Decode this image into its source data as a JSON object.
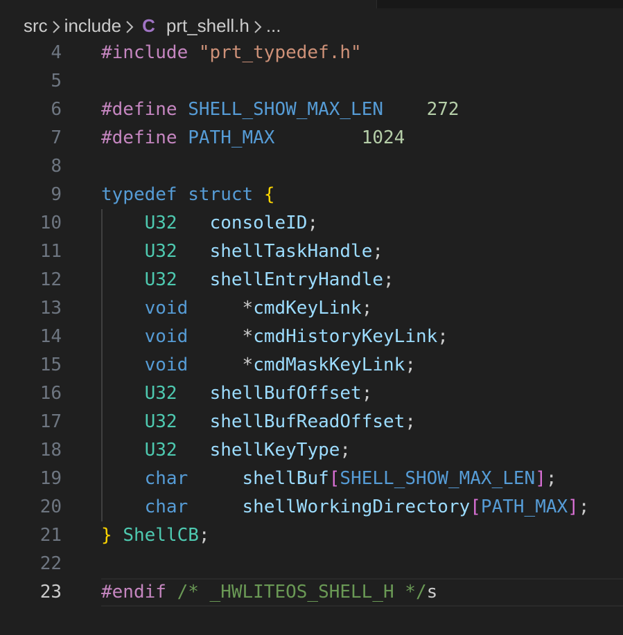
{
  "breadcrumb": {
    "items": [
      "src",
      "include",
      "prt_shell.h",
      "..."
    ],
    "file_icon": "C"
  },
  "editor": {
    "current_line": 23,
    "lines": [
      {
        "num": "4",
        "tokens": [
          [
            "#include ",
            "pre"
          ],
          [
            "\"prt_typedef.h\"",
            "str"
          ]
        ]
      },
      {
        "num": "5",
        "tokens": []
      },
      {
        "num": "6",
        "tokens": [
          [
            "#define ",
            "pre"
          ],
          [
            "SHELL_SHOW_MAX_LEN",
            "macro"
          ],
          [
            "    ",
            "punct"
          ],
          [
            "272",
            "num"
          ]
        ]
      },
      {
        "num": "7",
        "tokens": [
          [
            "#define ",
            "pre"
          ],
          [
            "PATH_MAX",
            "macro"
          ],
          [
            "        ",
            "punct"
          ],
          [
            "1024",
            "num"
          ]
        ]
      },
      {
        "num": "8",
        "tokens": []
      },
      {
        "num": "9",
        "tokens": [
          [
            "typedef",
            "kw"
          ],
          [
            " ",
            "punct"
          ],
          [
            "struct",
            "kw"
          ],
          [
            " ",
            "punct"
          ],
          [
            "{",
            "brace"
          ]
        ]
      },
      {
        "num": "10",
        "tokens": [
          [
            "    ",
            "punct"
          ],
          [
            "U32",
            "type"
          ],
          [
            "   ",
            "punct"
          ],
          [
            "consoleID",
            "var"
          ],
          [
            ";",
            "punct"
          ]
        ]
      },
      {
        "num": "11",
        "tokens": [
          [
            "    ",
            "punct"
          ],
          [
            "U32",
            "type"
          ],
          [
            "   ",
            "punct"
          ],
          [
            "shellTaskHandle",
            "var"
          ],
          [
            ";",
            "punct"
          ]
        ]
      },
      {
        "num": "12",
        "tokens": [
          [
            "    ",
            "punct"
          ],
          [
            "U32",
            "type"
          ],
          [
            "   ",
            "punct"
          ],
          [
            "shellEntryHandle",
            "var"
          ],
          [
            ";",
            "punct"
          ]
        ]
      },
      {
        "num": "13",
        "tokens": [
          [
            "    ",
            "punct"
          ],
          [
            "void",
            "kw"
          ],
          [
            "     ",
            "punct"
          ],
          [
            "*",
            "punct"
          ],
          [
            "cmdKeyLink",
            "var"
          ],
          [
            ";",
            "punct"
          ]
        ]
      },
      {
        "num": "14",
        "tokens": [
          [
            "    ",
            "punct"
          ],
          [
            "void",
            "kw"
          ],
          [
            "     ",
            "punct"
          ],
          [
            "*",
            "punct"
          ],
          [
            "cmdHistoryKeyLink",
            "var"
          ],
          [
            ";",
            "punct"
          ]
        ]
      },
      {
        "num": "15",
        "tokens": [
          [
            "    ",
            "punct"
          ],
          [
            "void",
            "kw"
          ],
          [
            "     ",
            "punct"
          ],
          [
            "*",
            "punct"
          ],
          [
            "cmdMaskKeyLink",
            "var"
          ],
          [
            ";",
            "punct"
          ]
        ]
      },
      {
        "num": "16",
        "tokens": [
          [
            "    ",
            "punct"
          ],
          [
            "U32",
            "type"
          ],
          [
            "   ",
            "punct"
          ],
          [
            "shellBufOffset",
            "var"
          ],
          [
            ";",
            "punct"
          ]
        ]
      },
      {
        "num": "17",
        "tokens": [
          [
            "    ",
            "punct"
          ],
          [
            "U32",
            "type"
          ],
          [
            "   ",
            "punct"
          ],
          [
            "shellBufReadOffset",
            "var"
          ],
          [
            ";",
            "punct"
          ]
        ]
      },
      {
        "num": "18",
        "tokens": [
          [
            "    ",
            "punct"
          ],
          [
            "U32",
            "type"
          ],
          [
            "   ",
            "punct"
          ],
          [
            "shellKeyType",
            "var"
          ],
          [
            ";",
            "punct"
          ]
        ]
      },
      {
        "num": "19",
        "tokens": [
          [
            "    ",
            "punct"
          ],
          [
            "char",
            "kw"
          ],
          [
            "     ",
            "punct"
          ],
          [
            "shellBuf",
            "var"
          ],
          [
            "[",
            "bracket"
          ],
          [
            "SHELL_SHOW_MAX_LEN",
            "macro"
          ],
          [
            "]",
            "bracket"
          ],
          [
            ";",
            "punct"
          ]
        ]
      },
      {
        "num": "20",
        "tokens": [
          [
            "    ",
            "punct"
          ],
          [
            "char",
            "kw"
          ],
          [
            "     ",
            "punct"
          ],
          [
            "shellWorkingDirectory",
            "var"
          ],
          [
            "[",
            "bracket"
          ],
          [
            "PATH_MAX",
            "macro"
          ],
          [
            "]",
            "bracket"
          ],
          [
            ";",
            "punct"
          ]
        ]
      },
      {
        "num": "21",
        "tokens": [
          [
            "}",
            "brace"
          ],
          [
            " ",
            "punct"
          ],
          [
            "ShellCB",
            "type"
          ],
          [
            ";",
            "punct"
          ]
        ]
      },
      {
        "num": "22",
        "tokens": []
      },
      {
        "num": "23",
        "tokens": [
          [
            "#endif",
            "pre"
          ],
          [
            " ",
            "punct"
          ],
          [
            "/* _HWLITEOS_SHELL_H */",
            "comment"
          ],
          [
            "s",
            "punct"
          ]
        ]
      }
    ]
  }
}
